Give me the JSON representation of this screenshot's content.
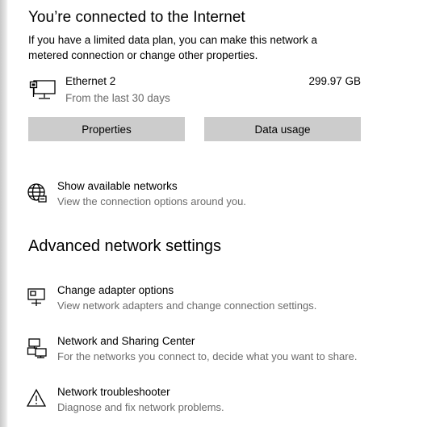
{
  "status": {
    "title": "You’re connected to the Internet",
    "description": "If you have a limited data plan, you can make this network a metered connection or change other properties."
  },
  "connection": {
    "name": "Ethernet 2",
    "period": "From the last 30 days",
    "usage": "299.97 GB",
    "icon": "ethernet-monitor-icon"
  },
  "buttons": {
    "properties": "Properties",
    "data_usage": "Data usage"
  },
  "show_networks": {
    "title": "Show available networks",
    "subtitle": "View the connection options around you.",
    "icon": "globe-icon"
  },
  "advanced": {
    "heading": "Advanced network settings",
    "items": [
      {
        "title": "Change adapter options",
        "subtitle": "View network adapters and change connection settings.",
        "icon": "network-adapter-icon"
      },
      {
        "title": "Network and Sharing Center",
        "subtitle": "For the networks you connect to, decide what you want to share.",
        "icon": "sharing-center-icon"
      },
      {
        "title": "Network troubleshooter",
        "subtitle": "Diagnose and fix network problems.",
        "icon": "warning-icon"
      }
    ]
  }
}
